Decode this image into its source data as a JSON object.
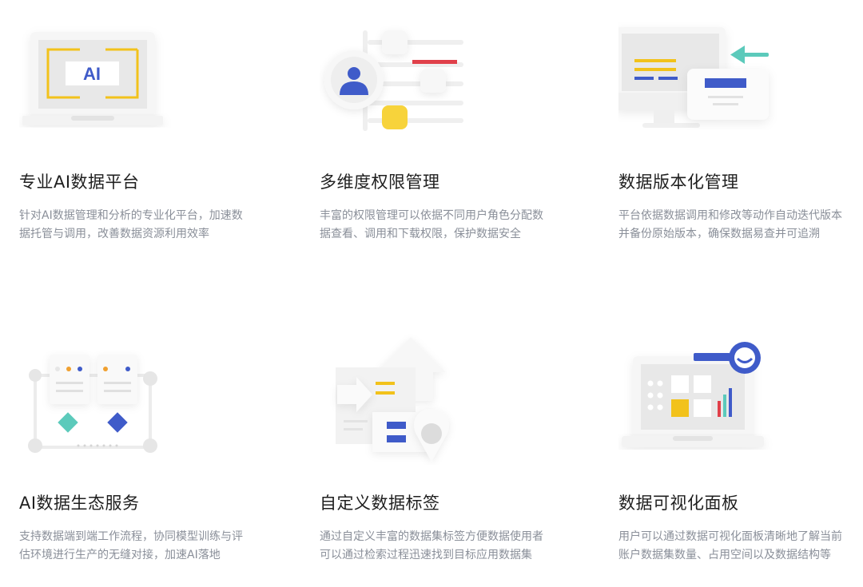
{
  "features": [
    {
      "title": "专业AI数据平台",
      "desc": "针对AI数据管理和分析的专业化平台，加速数据托管与调用，改善数据资源利用效率",
      "illustration_icon": "ai-laptop-icon",
      "illustration_text": "AI"
    },
    {
      "title": "多维度权限管理",
      "desc": "丰富的权限管理可以依据不同用户角色分配数据查看、调用和下载权限，保护数据安全",
      "illustration_icon": "user-permission-icon"
    },
    {
      "title": "数据版本化管理",
      "desc": "平台依据数据调用和修改等动作自动迭代版本并备份原始版本，确保数据易查并可追溯",
      "illustration_icon": "monitor-version-icon"
    },
    {
      "title": "AI数据生态服务",
      "desc": "支持数据端到端工作流程，协同模型训练与评估环境进行生产的无缝对接，加速AI落地",
      "illustration_icon": "workflow-ecosystem-icon"
    },
    {
      "title": "自定义数据标签",
      "desc": "通过自定义丰富的数据集标签方便数据使用者可以通过检索过程迅速找到目标应用数据集",
      "illustration_icon": "data-tag-icon"
    },
    {
      "title": "数据可视化面板",
      "desc": "用户可以通过数据可视化面板清晰地了解当前账户数据集数量、占用空间以及数据结构等",
      "illustration_icon": "visualization-dashboard-icon"
    }
  ],
  "colors": {
    "yellow": "#f2c21b",
    "blue": "#3f5bc9",
    "red": "#e0404a",
    "teal": "#5ccabb",
    "light_gray": "#f2f2f2",
    "mid_gray": "#e3e3e3",
    "title_text": "#1f1f1f",
    "desc_text": "#8a8f99"
  }
}
